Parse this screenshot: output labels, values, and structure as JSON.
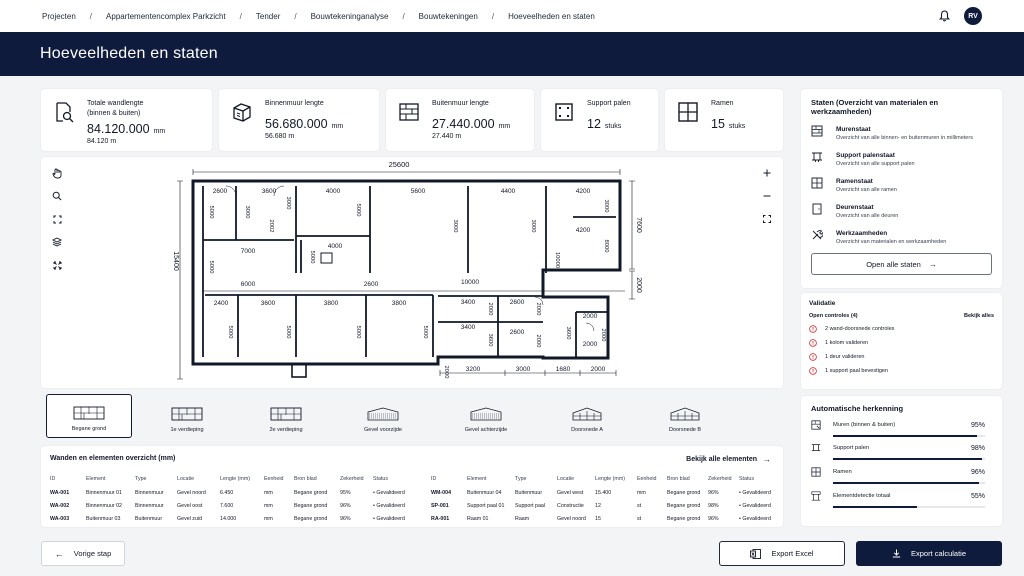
{
  "breadcrumb": [
    "Projecten",
    "Appartementencomplex Parkzicht",
    "Tender",
    "Bouwtekeninganalyse",
    "Bouwtekeningen",
    "Hoeveelheden en staten"
  ],
  "user_initials": "RV",
  "page_title": "Hoeveelheden en staten",
  "stats": [
    {
      "label": "Totale wandlengte",
      "label2": "(binnen & buiten)",
      "value": "84.120.000",
      "unit": "mm",
      "sub": "84.120 m",
      "icon": "search-plan-icon"
    },
    {
      "label": "Binnenmuur lengte",
      "label2": "",
      "value": "56.680.000",
      "unit": "mm",
      "sub": "56.680 m",
      "icon": "cube-icon"
    },
    {
      "label": "Buitenmuur lengte",
      "label2": "",
      "value": "27.440.000",
      "unit": "mm",
      "sub": "27.440 m",
      "icon": "wall-icon"
    },
    {
      "label": "Support palen",
      "label2": "",
      "value": "12",
      "unit": "stuks",
      "sub": "",
      "icon": "pillar-icon"
    },
    {
      "label": "Ramen",
      "label2": "",
      "value": "15",
      "unit": "stuks",
      "sub": "",
      "icon": "window-icon"
    }
  ],
  "states": {
    "title": "Staten (Overzicht van materialen en werkzaamheden)",
    "items": [
      {
        "title": "Murenstaat",
        "desc": "Overzicht van alle binnen- en buitenmuren in millimeters",
        "icon": "wall-list-icon"
      },
      {
        "title": "Support palenstaat",
        "desc": "Overzicht van alle support palen",
        "icon": "support-icon"
      },
      {
        "title": "Ramenstaat",
        "desc": "Overzicht van alle ramen",
        "icon": "window-icon"
      },
      {
        "title": "Deurenstaat",
        "desc": "Overzicht van alle deuren",
        "icon": "door-icon"
      },
      {
        "title": "Werkzaamheden",
        "desc": "Overzicht van materialen en werkzaamheden",
        "icon": "tools-icon"
      }
    ],
    "open_all": "Open alle staten"
  },
  "validation": {
    "title": "Validatie",
    "open_checks": "Open controles (4)",
    "view_all": "Bekijk alles",
    "items": [
      "2 wand-doorsnede controles",
      "1 kolom valideren",
      "1 deur valideren",
      "1 support paal bevestigen"
    ]
  },
  "recognition": {
    "title": "Automatische herkenning",
    "items": [
      {
        "label": "Muren (binnen & buiten)",
        "pct": "95%",
        "value": 0.95
      },
      {
        "label": "Support palen",
        "pct": "98%",
        "value": 0.98
      },
      {
        "label": "Ramen",
        "pct": "96%",
        "value": 0.96
      },
      {
        "label": "Elementdetectie totaal",
        "pct": "55%",
        "value": 0.55
      }
    ]
  },
  "plan": {
    "dims": {
      "top": "25600",
      "right_top": "7600",
      "right_bottom": "2000",
      "left": "15400",
      "r1": [
        "2600",
        "3600",
        "4000",
        "5600",
        "4400",
        "4200"
      ],
      "v1": [
        "5000",
        "3000",
        "3000",
        "5000",
        "3000",
        "3000",
        "5000"
      ],
      "mid": [
        "7000",
        "4000",
        "4200",
        "6000",
        "2600",
        "10000"
      ],
      "v2": [
        "2002",
        "3000",
        "5000",
        "8000",
        "10000"
      ],
      "r3": [
        "2400",
        "3600",
        "3800",
        "3800",
        "3400",
        "2600",
        "2000",
        "3400",
        "2600",
        "2000"
      ],
      "v3": [
        "5000",
        "5000",
        "5000",
        "5000",
        "2000",
        "2000",
        "3600",
        "3600",
        "2000",
        "2000"
      ],
      "bottom": [
        "3200",
        "3000",
        "1680",
        "2000",
        "2000"
      ]
    }
  },
  "floors": [
    "Begane grond",
    "1e verdieping",
    "2e verdieping",
    "Gevel voorzijde",
    "Gevel achterzijde",
    "Doorsnede A",
    "Doorsnede B"
  ],
  "table": {
    "title": "Wanden en elementen overzicht (mm)",
    "view_all": "Bekijk alle elementen",
    "headers": [
      "ID",
      "Element",
      "Type",
      "Locatie",
      "Lengte (mm)",
      "Eenheid",
      "Bron blad",
      "Zekerheid",
      "Status"
    ],
    "left_rows": [
      [
        "WA-001",
        "Binnenmuur 01",
        "Binnenmuur",
        "Gevel noord",
        "6.450",
        "mm",
        "Begane grond",
        "95%",
        "• Gevalideerd"
      ],
      [
        "WA-002",
        "Binnenmuur 02",
        "Binnenmuur",
        "Gevel oost",
        "7.600",
        "mm",
        "Begane grond",
        "96%",
        "• Gevalideerd"
      ],
      [
        "WA-003",
        "Buitenmuur 03",
        "Buitenmuur",
        "Gevel zuid",
        "14.000",
        "mm",
        "Begane grond",
        "96%",
        "• Gevalideerd"
      ]
    ],
    "right_rows": [
      [
        "WM-004",
        "Buitenmuur 04",
        "Buitenmuur",
        "Gevel west",
        "15.400",
        "mm",
        "Begane grond",
        "96%",
        "• Gevalideerd"
      ],
      [
        "SP-001",
        "Support paal 01",
        "Support paal",
        "Constructie",
        "12",
        "st",
        "Begane grond",
        "98%",
        "• Gevalideerd"
      ],
      [
        "RA-001",
        "Raam 01",
        "Raam",
        "Gevel noord",
        "15",
        "st",
        "Begane grond",
        "96%",
        "• Gevalideerd"
      ]
    ]
  },
  "footer": {
    "prev": "Vorige stap",
    "excel": "Export Excel",
    "calc": "Export calculatie"
  }
}
